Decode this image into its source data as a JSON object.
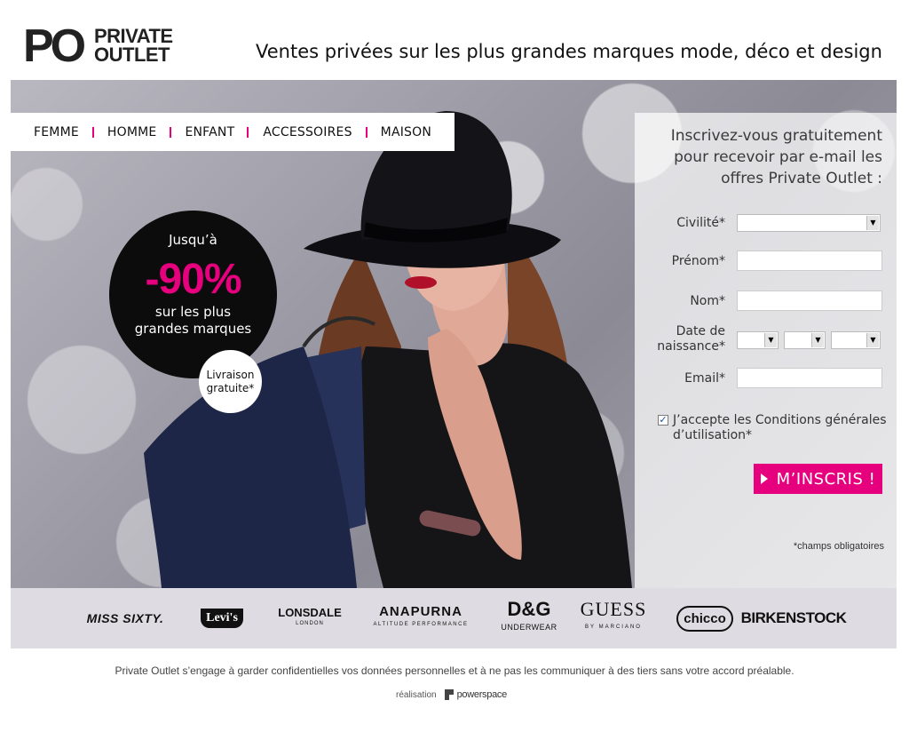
{
  "header": {
    "logo_mark": "PO",
    "logo_line1": "PRIVATE",
    "logo_line2": "OUTLET",
    "tagline": "Ventes privées sur les plus grandes marques mode, déco et design"
  },
  "nav": {
    "items": [
      {
        "label": "FEMME"
      },
      {
        "label": "HOMME"
      },
      {
        "label": "ENFANT"
      },
      {
        "label": "ACCESSOIRES"
      },
      {
        "label": "MAISON"
      }
    ],
    "separator_color": "#e6007e"
  },
  "promo": {
    "upto": "Jusqu’à",
    "discount": "-90%",
    "brands_line1": "sur les plus",
    "brands_line2": "grandes marques",
    "delivery_line1": "Livraison",
    "delivery_line2": "gratuite*"
  },
  "form": {
    "intro": "Inscrivez-vous gratuitement pour recevoir par e-mail les offres Private Outlet :",
    "civility_label": "Civilité*",
    "civility_value": "",
    "firstname_label": "Prénom*",
    "firstname_value": "",
    "lastname_label": "Nom*",
    "lastname_value": "",
    "birth_label_line1": "Date de",
    "birth_label_line2": "naissance*",
    "birth_day": "",
    "birth_month": "",
    "birth_year": "",
    "email_label": "Email*",
    "email_value": "",
    "terms_checked": true,
    "terms_text": "J’accepte les Conditions générales d’utilisation*",
    "submit_label": "M’INSCRIS !",
    "required_note": "*champs obligatoires"
  },
  "brands": [
    {
      "name": "MISS SIXTY."
    },
    {
      "name": "Levi's"
    },
    {
      "name": "LONSDALE",
      "sub": "LONDON"
    },
    {
      "name": "ANAPURNA",
      "sub": "ALTITUDE PERFORMANCE"
    },
    {
      "name": "D&G",
      "sub": "UNDERWEAR"
    },
    {
      "name": "GUESS",
      "sub": "BY MARCIANO"
    },
    {
      "name": "chicco"
    },
    {
      "name": "BIRKENSTOCK"
    }
  ],
  "footer": {
    "privacy": "Private Outlet s’engage à garder confidentielles vos données personnelles et à ne pas les communiquer à des tiers sans votre accord préalable.",
    "credit_label": "réalisation",
    "credit_brand": "powerspace"
  },
  "colors": {
    "accent": "#e6007e",
    "badge_bg": "#0c0c0c"
  }
}
